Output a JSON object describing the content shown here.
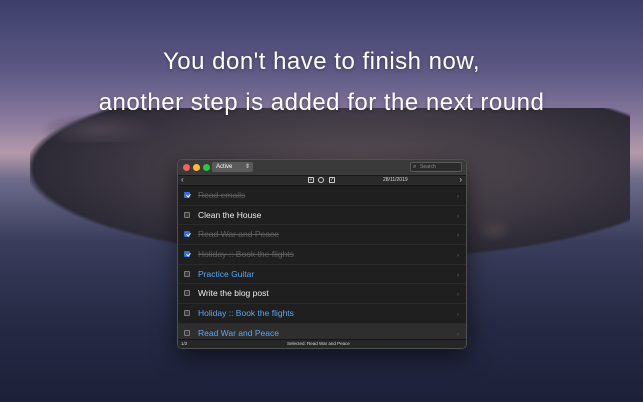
{
  "headline": {
    "line1": "You don't have to finish now,",
    "line2": "another step is added for the next round"
  },
  "window": {
    "filter_value": "Active",
    "search_placeholder": "Search",
    "date": "28/11/2019",
    "tasks": [
      {
        "label": "Read emails",
        "checked": true,
        "style": "done"
      },
      {
        "label": "Clean the House",
        "checked": false,
        "style": "open"
      },
      {
        "label": "Read War and Peace",
        "checked": true,
        "style": "done"
      },
      {
        "label": "Holiday :: Book the flights",
        "checked": true,
        "style": "done"
      },
      {
        "label": "Practice Guitar",
        "checked": false,
        "style": "link"
      },
      {
        "label": "Write the blog post",
        "checked": false,
        "style": "open"
      },
      {
        "label": "Holiday :: Book the flights",
        "checked": false,
        "style": "link"
      },
      {
        "label": "Read War and Peace",
        "checked": false,
        "style": "link",
        "selected": true
      }
    ],
    "status": {
      "count": "1/2",
      "selected": "Selected: Read War and Peace"
    }
  },
  "colors": {
    "accent": "#2f6fe0",
    "link": "#5aa7f2",
    "close": "#ff5f57",
    "minimize": "#febc2e",
    "zoom": "#28c840"
  },
  "icons": {
    "prev": "chevron-left-icon",
    "next": "chevron-right-icon",
    "add": "plus-square-icon",
    "circle": "circle-icon",
    "check": "check-square-icon",
    "search": "search-icon"
  }
}
